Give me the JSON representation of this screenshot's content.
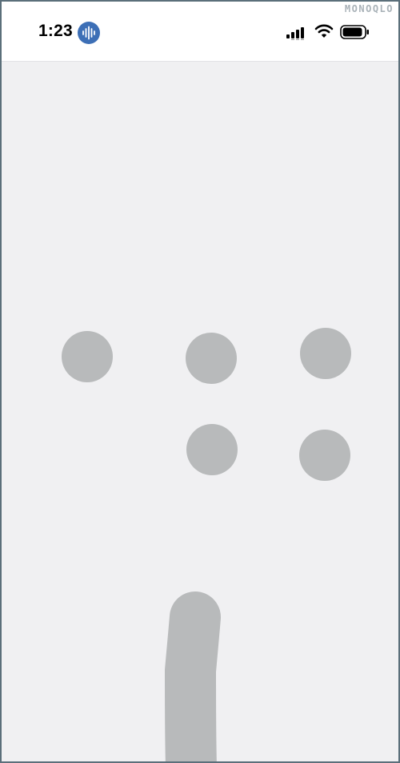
{
  "status_bar": {
    "time": "1:23",
    "icons": [
      "voice-assistant-icon",
      "signal-icon",
      "wifi-icon",
      "battery-icon"
    ]
  },
  "watermark": "MONOQLO",
  "colors": {
    "background": "#f0f0f2",
    "dot": "#b8babb",
    "badge": "#3d6fb6",
    "frame_border": "#5b6f7a"
  }
}
